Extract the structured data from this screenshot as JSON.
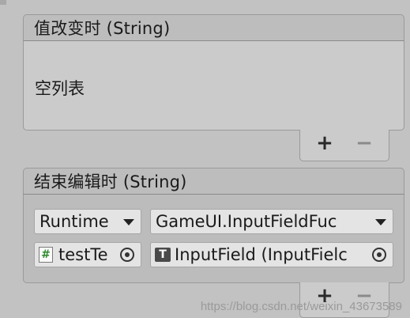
{
  "value_changed": {
    "header": "值改变时 (String)",
    "empty_label": "空列表",
    "add_symbol": "+",
    "remove_symbol": "−"
  },
  "end_edit": {
    "header": "结束编辑时 (String)",
    "listener": {
      "call_state": "Runtime",
      "function": "GameUI.InputFieldFuc",
      "target_object": "testTe",
      "target_icon": "script-icon",
      "argument": "InputField (InputFielc",
      "argument_icon": "input-field-component-icon"
    },
    "add_symbol": "+",
    "remove_symbol": "−"
  },
  "watermark": "https://blog.csdn.net/weixin_43673589"
}
